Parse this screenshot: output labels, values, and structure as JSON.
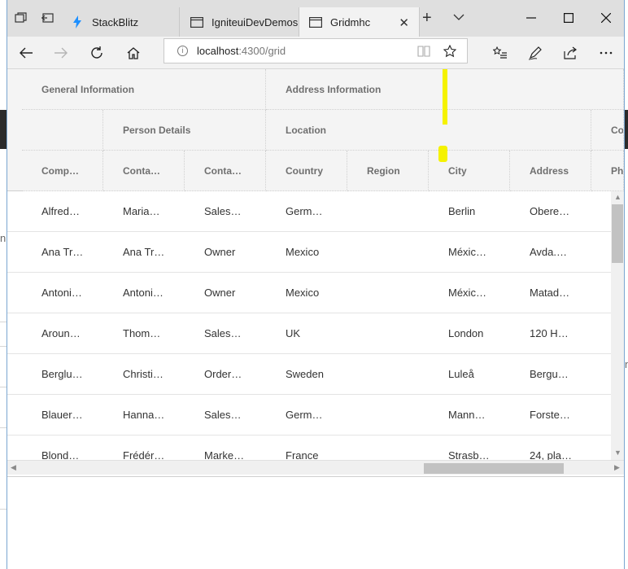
{
  "tabs": [
    {
      "label": "StackBlitz",
      "icon": "lightning-icon"
    },
    {
      "label": "IgniteuiDevDemos",
      "icon": "page-icon"
    },
    {
      "label": "Gridmhc",
      "icon": "page-icon",
      "active": true
    }
  ],
  "address": {
    "host": "localhost",
    "path": ":4300/grid"
  },
  "background_page": {
    "left_fragment": "n",
    "right_fragment": "n"
  },
  "grid": {
    "groups_level1": [
      {
        "label": "General Information"
      },
      {
        "label": "Address Information"
      }
    ],
    "groups_level2": [
      {
        "label": "Person Details"
      },
      {
        "label": "Location"
      },
      {
        "label": "Co"
      }
    ],
    "columns": [
      "Comp…",
      "Conta…",
      "Conta…",
      "Country",
      "Region",
      "City",
      "Address",
      "Ph"
    ],
    "rows": [
      [
        "Alfred…",
        "Maria…",
        "Sales…",
        "Germ…",
        "",
        "Berlin",
        "Obere…"
      ],
      [
        "Ana Tr…",
        "Ana Tr…",
        "Owner",
        "Mexico",
        "",
        "Méxic…",
        "Avda.…"
      ],
      [
        "Antoni…",
        "Antoni…",
        "Owner",
        "Mexico",
        "",
        "Méxic…",
        "Matad…"
      ],
      [
        "Aroun…",
        "Thom…",
        "Sales…",
        "UK",
        "",
        "London",
        "120 H…"
      ],
      [
        "Berglu…",
        "Christi…",
        "Order…",
        "Sweden",
        "",
        "Luleå",
        "Bergu…"
      ],
      [
        "Blauer…",
        "Hanna…",
        "Sales…",
        "Germ…",
        "",
        "Mann…",
        "Forste…"
      ],
      [
        "Blond…",
        "Frédér…",
        "Marke…",
        "France",
        "",
        "Strasb…",
        "24, pla…"
      ]
    ]
  },
  "colors": {
    "highlight": "#f5f200",
    "accent_lightning": "#1e90ff"
  }
}
